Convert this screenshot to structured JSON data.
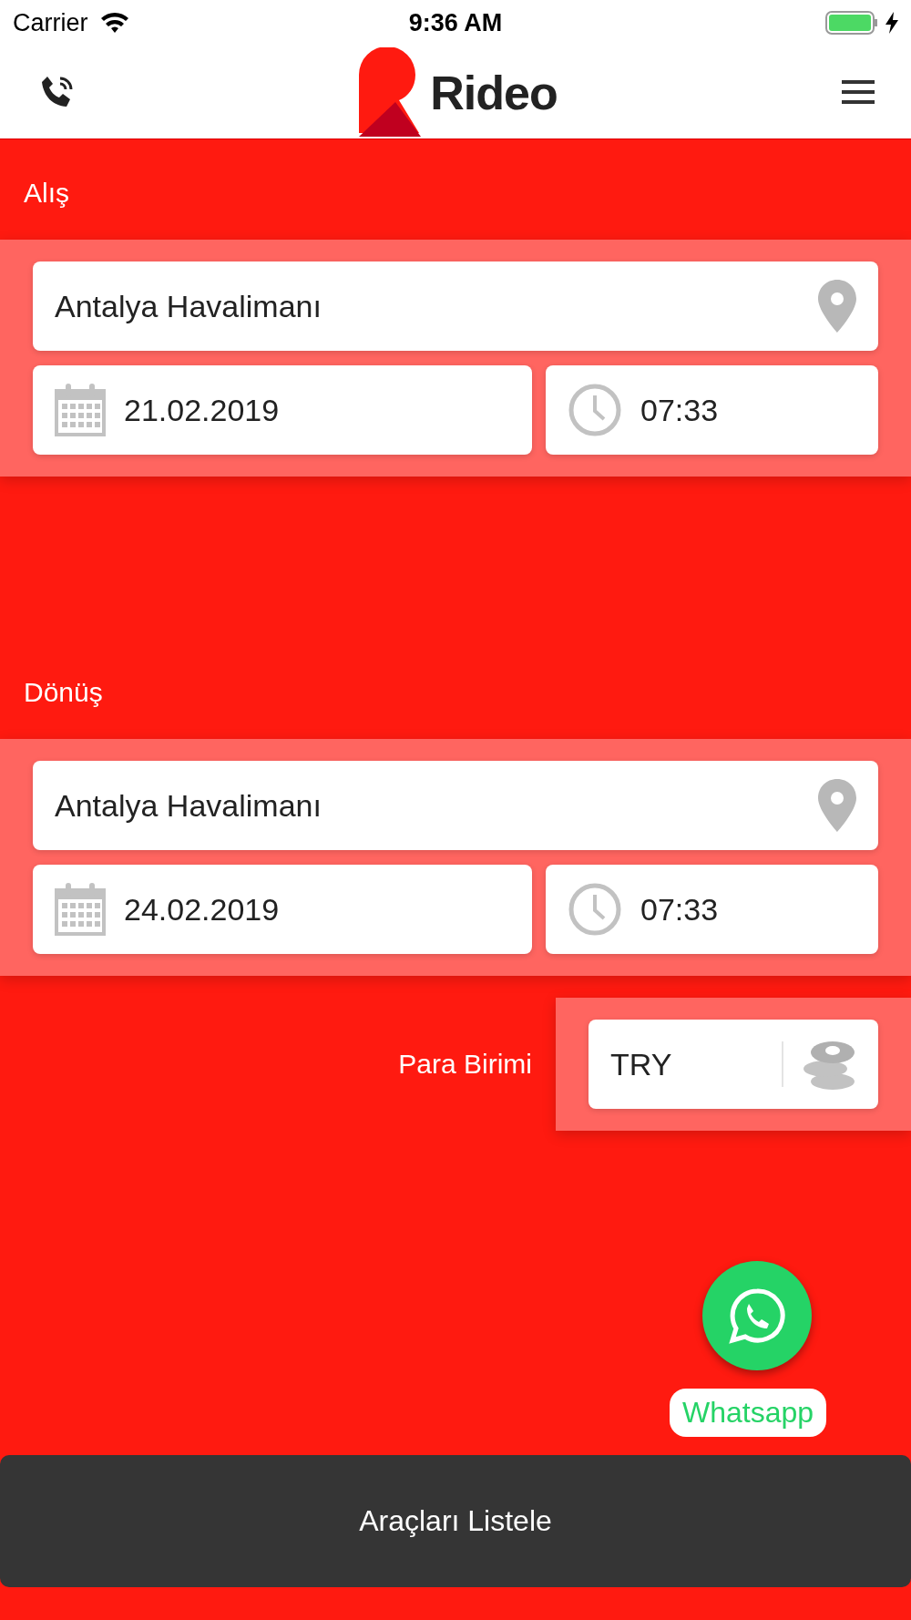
{
  "status_bar": {
    "carrier": "Carrier",
    "time": "9:36 AM",
    "charging": true
  },
  "header": {
    "logo_text": "Rideo"
  },
  "sections": [
    {
      "title": "Alış",
      "location": "Antalya Havalimanı",
      "date": "21.02.2019",
      "time": "07:33"
    },
    {
      "title": "Dönüş",
      "location": "Antalya Havalimanı",
      "date": "24.02.2019",
      "time": "07:33"
    }
  ],
  "currency": {
    "label": "Para Birimi",
    "value": "TRY"
  },
  "whatsapp": {
    "label": "Whatsapp"
  },
  "list_button": "Araçları Listele"
}
